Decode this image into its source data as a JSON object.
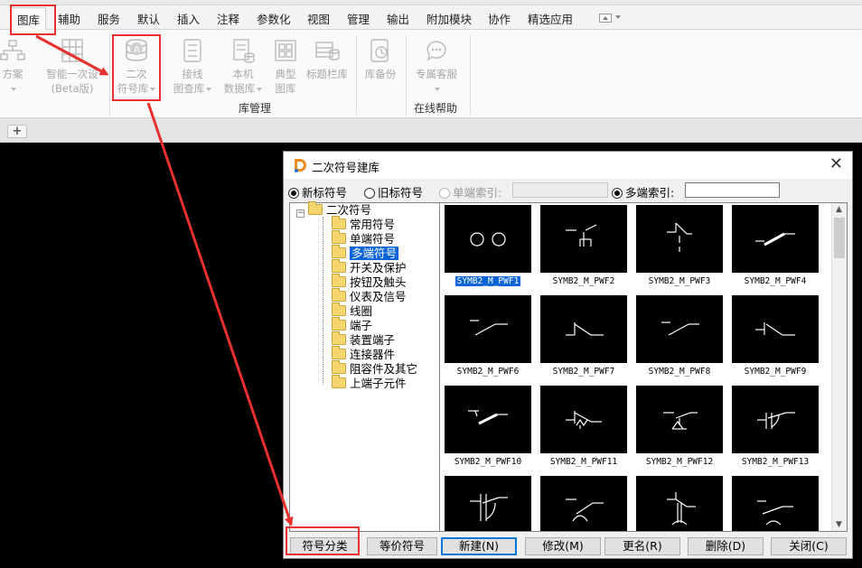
{
  "menubar": {
    "items": [
      {
        "label": "图库",
        "active": true
      },
      {
        "label": "辅助"
      },
      {
        "label": "服务"
      },
      {
        "label": "默认"
      },
      {
        "label": "插入"
      },
      {
        "label": "注释"
      },
      {
        "label": "参数化"
      },
      {
        "label": "视图"
      },
      {
        "label": "管理"
      },
      {
        "label": "输出"
      },
      {
        "label": "附加模块"
      },
      {
        "label": "协作"
      },
      {
        "label": "精选应用"
      }
    ]
  },
  "ribbon": {
    "buttons": {
      "fangan": {
        "line1": "方案",
        "line2": ""
      },
      "smart": {
        "line1": "智能一次设",
        "line2": "(Beta版)"
      },
      "secondary": {
        "line1": "二次",
        "line2": "符号库"
      },
      "wiring": {
        "line1": "接线",
        "line2": "图查库"
      },
      "local": {
        "line1": "本机",
        "line2": "数据库"
      },
      "typical": {
        "line1": "典型",
        "line2": "图库"
      },
      "titlebar": {
        "line1": "标题栏库",
        "line2": ""
      },
      "backup": {
        "line1": "库备份",
        "line2": ""
      },
      "service": {
        "line1": "专属客服",
        "line2": ""
      }
    },
    "groups": {
      "library": "库管理",
      "online": "在线帮助"
    },
    "tab_plus": "+"
  },
  "dialog": {
    "title": "二次符号建库",
    "close": "✕",
    "radios": {
      "new_symbol": "新标符号",
      "old_symbol": "旧标符号",
      "single_index": "单端索引:",
      "multi_index": "多端索引:"
    },
    "tree": {
      "root": "二次符号",
      "expander": "−",
      "children": [
        "常用符号",
        "单端符号",
        "多端符号",
        "开关及保护",
        "按钮及触头",
        "仪表及信号",
        "线圈",
        "端子",
        "装置端子",
        "连接器件",
        "阻容件及其它",
        "上端子元件"
      ],
      "selected": "多端符号"
    },
    "symbols": [
      "SYMB2_M_PWF1",
      "SYMB2_M_PWF2",
      "SYMB2_M_PWF3",
      "SYMB2_M_PWF4",
      "SYMB2_M_PWF6",
      "SYMB2_M_PWF7",
      "SYMB2_M_PWF8",
      "SYMB2_M_PWF9",
      "SYMB2_M_PWF10",
      "SYMB2_M_PWF11",
      "SYMB2_M_PWF12",
      "SYMB2_M_PWF13",
      "",
      "",
      "",
      ""
    ],
    "selected_symbol": "SYMB2_M_PWF1",
    "buttons": {
      "classify": "符号分类",
      "equivalent": "等价符号",
      "new": "新建(N)",
      "modify": "修改(M)",
      "rename": "更名(R)",
      "delete": "删除(D)",
      "close": "关闭(C)"
    }
  },
  "colors": {
    "annotation": "#e8312e",
    "selection": "#0a64d6"
  }
}
